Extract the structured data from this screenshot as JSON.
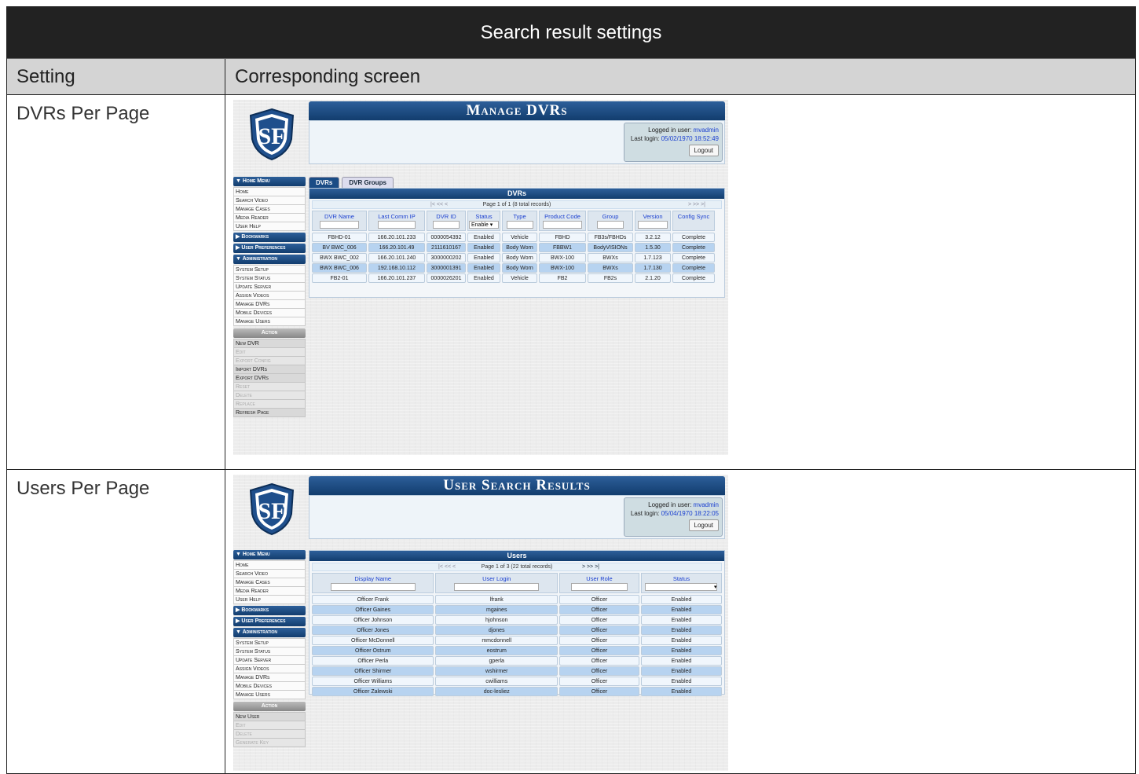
{
  "doc": {
    "title": "Search result settings",
    "col_setting": "Setting",
    "col_screen": "Corresponding screen",
    "rows": [
      {
        "setting": "DVRs Per Page"
      },
      {
        "setting": "Users Per Page"
      }
    ]
  },
  "common": {
    "logged_in_label": "Logged in user:",
    "user": "mvadmin",
    "last_login_label": "Last login:",
    "logout": "Logout",
    "home_menu": "▼ Home Menu",
    "home_items": [
      "Home",
      "Search Video",
      "Manage Cases",
      "Media Reader",
      "User Help"
    ],
    "bookmarks": "▶ Bookmarks",
    "user_prefs": "▶ User Preferences",
    "administration": "▼ Administration",
    "admin_items": [
      "System Setup",
      "System Status",
      "Update Server",
      "Assign Videos",
      "Manage DVRs",
      "Mobile Devices",
      "Manage Users"
    ],
    "action": "Action"
  },
  "dvr": {
    "banner": "Manage DVRs",
    "last_login": "05/02/1970 18:52:49",
    "tabs": [
      "DVRs",
      "DVR Groups"
    ],
    "panel_title": "DVRs",
    "pager": "Page 1 of 1 (8 total records)",
    "pager_left": "|< << <",
    "pager_right": "> >> >|",
    "columns": [
      "DVR Name",
      "Last Comm IP",
      "DVR ID",
      "Status",
      "Type",
      "Product Code",
      "Group",
      "Version",
      "Config Sync"
    ],
    "status_filter": "Enable ▾",
    "rows": [
      [
        "FBHD-01",
        "166.20.101.233",
        "0000054392",
        "Enabled",
        "Vehicle",
        "FBHD",
        "FB3s/FBHDs",
        "3.2.12",
        "Complete"
      ],
      [
        "BV BWC_006",
        "166.20.101.49",
        "2111610167",
        "Enabled",
        "Body Worn",
        "FBBW1",
        "BodyVISIONs",
        "1.5.30",
        "Complete"
      ],
      [
        "BWX BWC_002",
        "166.20.101.240",
        "3000000202",
        "Enabled",
        "Body Worn",
        "BWX-100",
        "BWXs",
        "1.7.123",
        "Complete"
      ],
      [
        "BWX BWC_006",
        "192.168.10.112",
        "3000001391",
        "Enabled",
        "Body Worn",
        "BWX-100",
        "BWXs",
        "1.7.130",
        "Complete"
      ],
      [
        "FB2-01",
        "166.20.101.237",
        "0000026201",
        "Enabled",
        "Vehicle",
        "FB2",
        "FB2s",
        "2.1.20",
        "Complete"
      ]
    ],
    "actions": [
      {
        "label": "New DVR",
        "enabled": true
      },
      {
        "label": "Edit",
        "enabled": false
      },
      {
        "label": "Export Config",
        "enabled": false
      },
      {
        "label": "Import DVRs",
        "enabled": true
      },
      {
        "label": "Export DVRs",
        "enabled": true
      },
      {
        "label": "Reset",
        "enabled": false
      },
      {
        "label": "Delete",
        "enabled": false
      },
      {
        "label": "Replace",
        "enabled": false
      },
      {
        "label": "Refresh Page",
        "enabled": true
      }
    ]
  },
  "users": {
    "banner": "User Search Results",
    "last_login": "05/04/1970 18:22:05",
    "panel_title": "Users",
    "pager": "Page 1 of 3 (22 total records)",
    "pager_left": "|< << <",
    "pager_right": "> >> >|",
    "columns": [
      "Display Name",
      "User Login",
      "User Role",
      "Status"
    ],
    "rows": [
      [
        "Officer Frank",
        "lfrank",
        "Officer",
        "Enabled"
      ],
      [
        "Officer Gaines",
        "mgaines",
        "Officer",
        "Enabled"
      ],
      [
        "Officer Johnson",
        "hjohnson",
        "Officer",
        "Enabled"
      ],
      [
        "Officer Jones",
        "djones",
        "Officer",
        "Enabled"
      ],
      [
        "Officer McDonnell",
        "mmcdonnell",
        "Officer",
        "Enabled"
      ],
      [
        "Officer Ostrum",
        "eostrum",
        "Officer",
        "Enabled"
      ],
      [
        "Officer Perla",
        "gperla",
        "Officer",
        "Enabled"
      ],
      [
        "Officer Shirmer",
        "wshirmer",
        "Officer",
        "Enabled"
      ],
      [
        "Officer Williams",
        "cwilliams",
        "Officer",
        "Enabled"
      ],
      [
        "Officer Zalewski",
        "doc-lesliez",
        "Officer",
        "Enabled"
      ]
    ],
    "actions": [
      {
        "label": "New User",
        "enabled": true
      },
      {
        "label": "Edit",
        "enabled": false
      },
      {
        "label": "Delete",
        "enabled": false
      },
      {
        "label": "Generate Key",
        "enabled": false
      }
    ]
  }
}
